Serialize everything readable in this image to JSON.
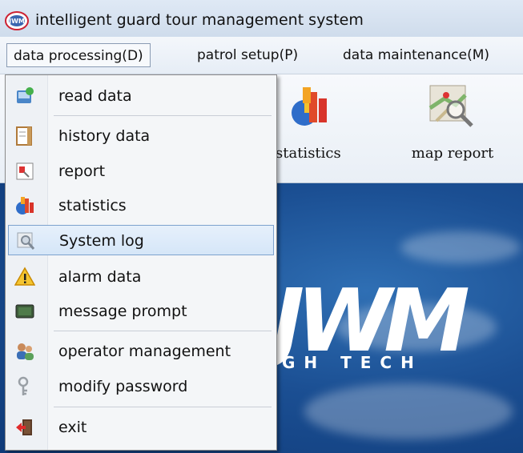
{
  "window": {
    "title": "intelligent guard tour management system",
    "icon": "app-logo-icon"
  },
  "menubar": {
    "items": [
      {
        "label": "data processing(D)",
        "active": true
      },
      {
        "label": "patrol setup(P)",
        "active": false
      },
      {
        "label": "data maintenance(M)",
        "active": false
      }
    ]
  },
  "toolbar": {
    "statistics_label": "statistics",
    "map_report_label": "map report"
  },
  "banner": {
    "logo": "JWM",
    "tagline": "GH TECH"
  },
  "dropdown": {
    "items": [
      {
        "label": "read data",
        "icon": "read-data-icon"
      },
      {
        "label": "history data",
        "icon": "history-data-icon"
      },
      {
        "label": "report",
        "icon": "report-icon"
      },
      {
        "label": "statistics",
        "icon": "statistics-icon"
      },
      {
        "label": "System log",
        "icon": "system-log-icon",
        "highlighted": true
      },
      {
        "label": "alarm data",
        "icon": "alarm-icon"
      },
      {
        "label": "message prompt",
        "icon": "message-prompt-icon"
      },
      {
        "label": "operator management",
        "icon": "operator-management-icon"
      },
      {
        "label": "modify password",
        "icon": "password-key-icon"
      },
      {
        "label": "exit",
        "icon": "exit-icon"
      }
    ]
  },
  "colors": {
    "menu_highlight": "#d5e6f8",
    "banner_blue": "#1b4f93"
  }
}
